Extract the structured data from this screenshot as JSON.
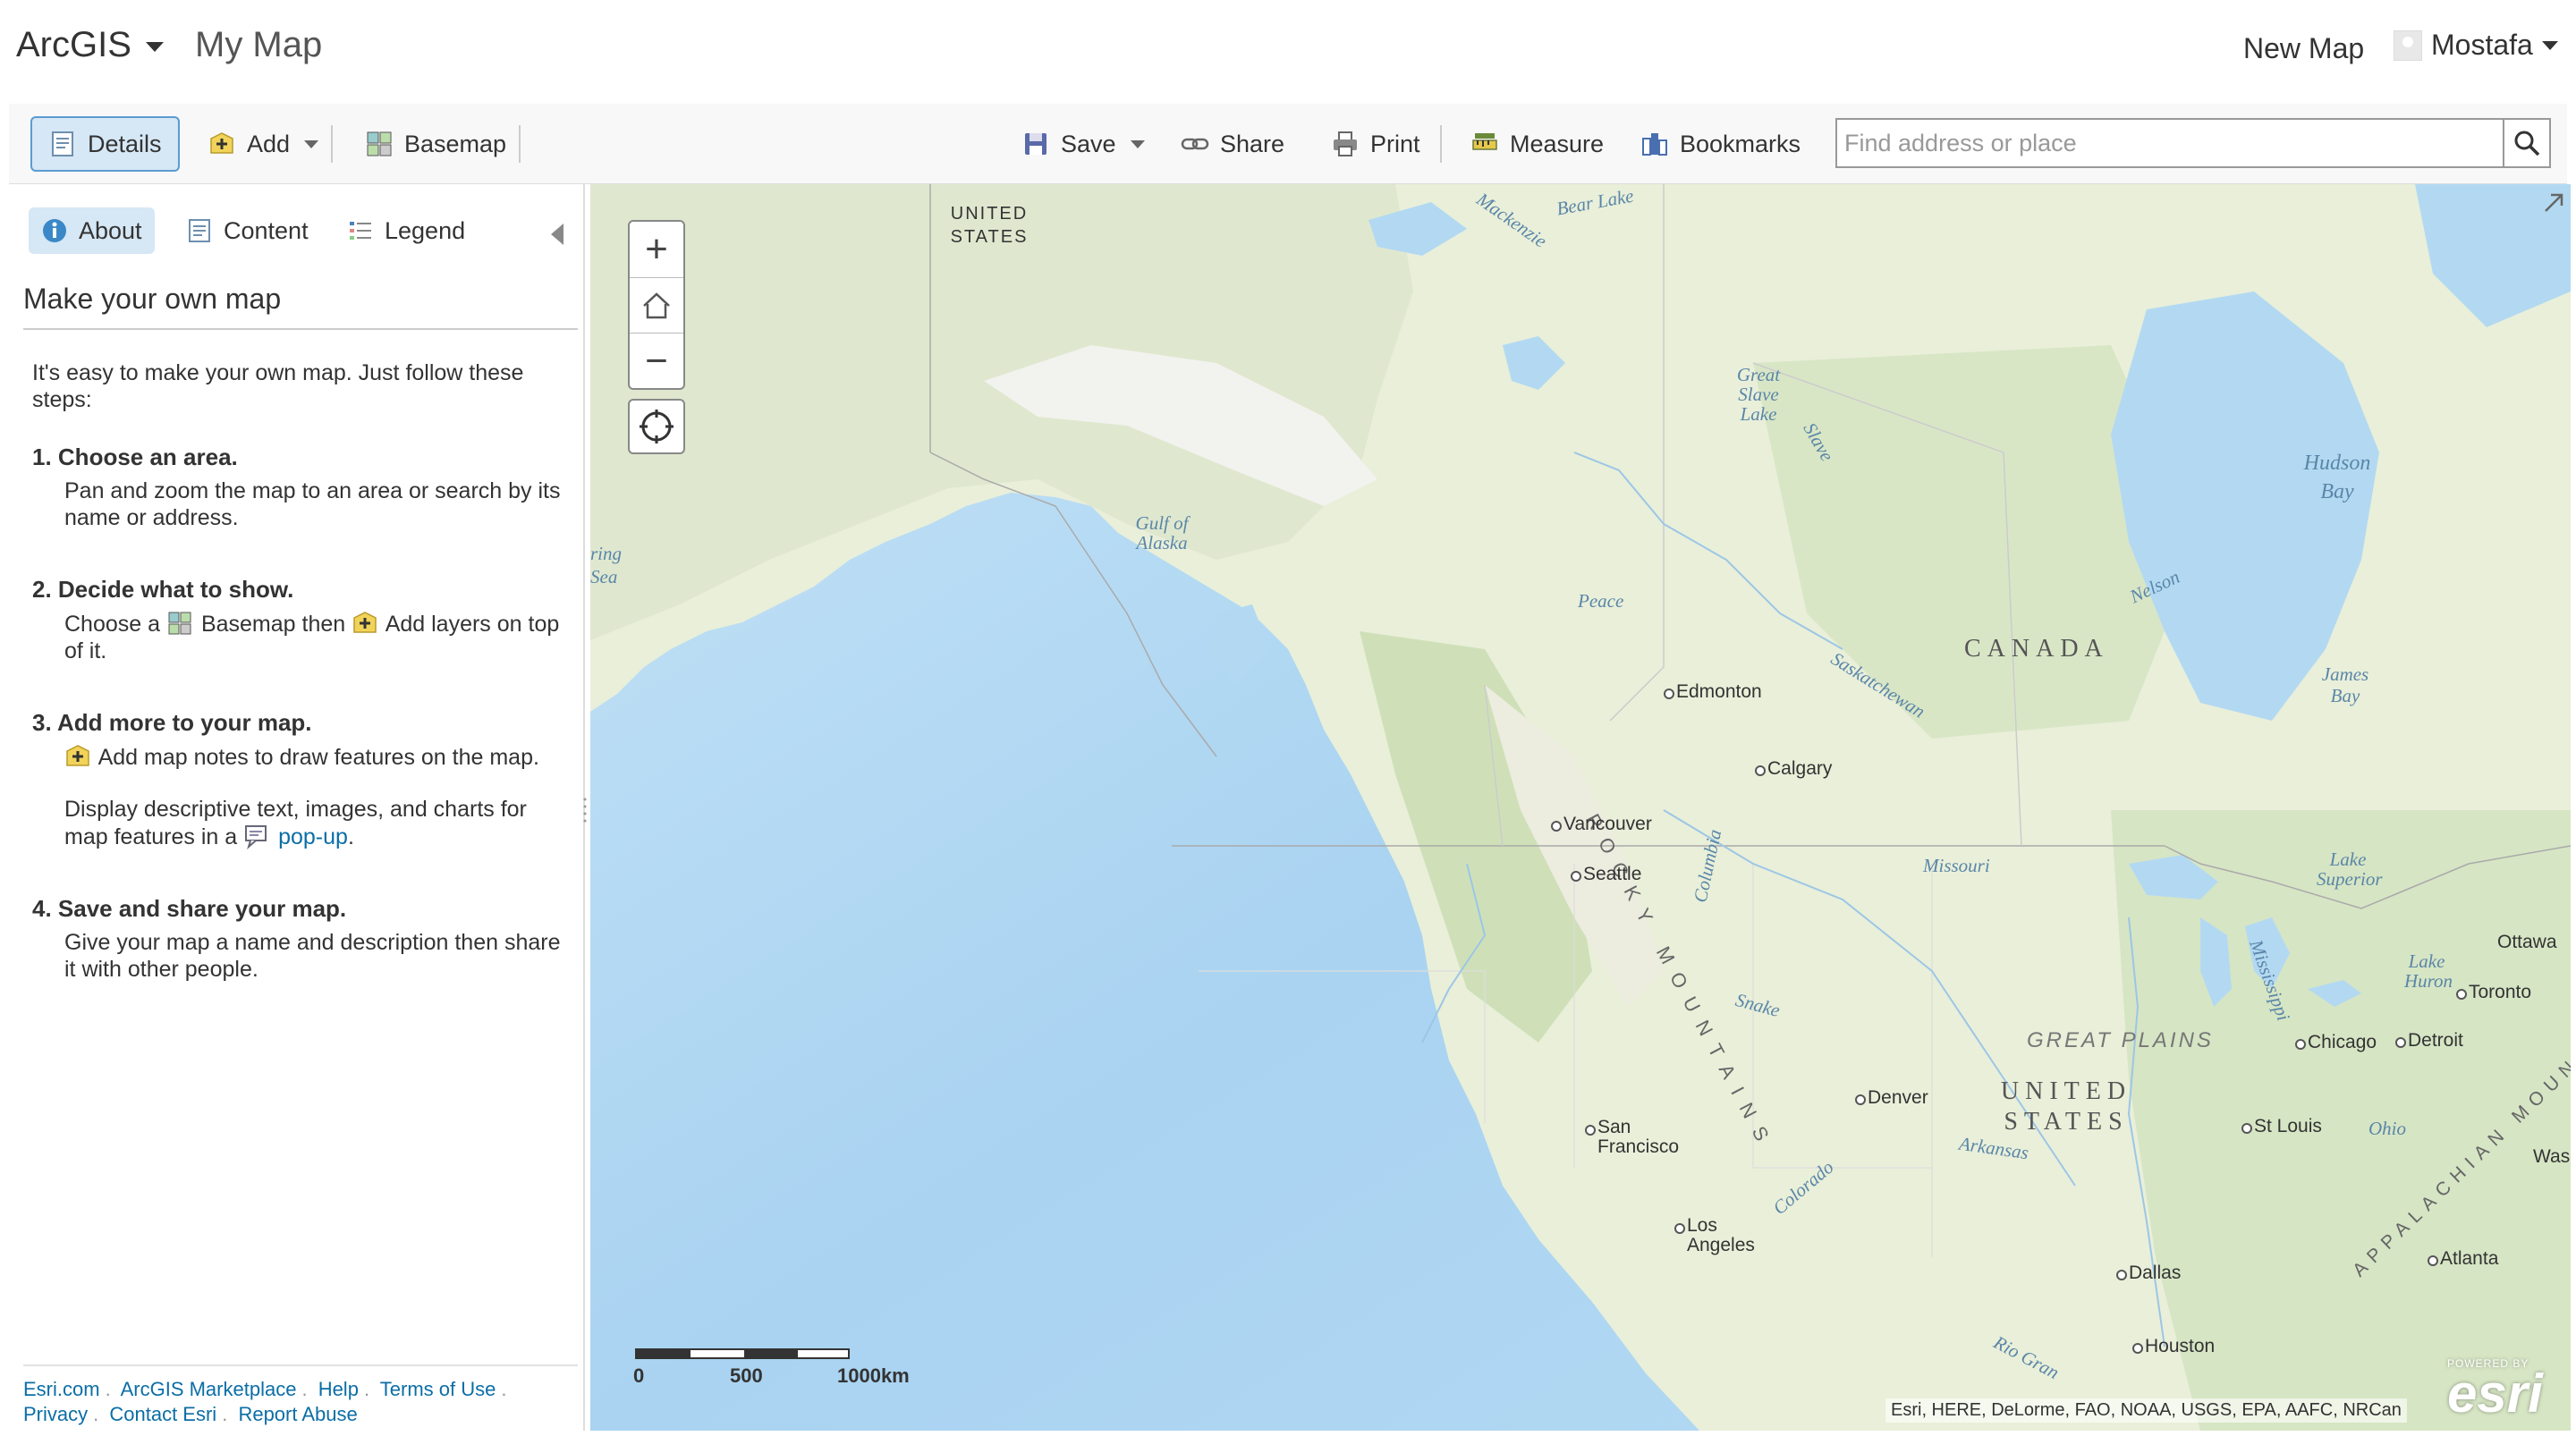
{
  "header": {
    "brand": "ArcGIS",
    "map_title": "My Map",
    "new_map": "New Map",
    "user": "Mostafa"
  },
  "toolbar": {
    "details": "Details",
    "add": "Add",
    "basemap": "Basemap",
    "save": "Save",
    "share": "Share",
    "print": "Print",
    "measure": "Measure",
    "bookmarks": "Bookmarks",
    "search_placeholder": "Find address or place"
  },
  "sidebar": {
    "tabs": {
      "about": "About",
      "content": "Content",
      "legend": "Legend"
    },
    "heading": "Make your own map",
    "intro": "It's easy to make your own map. Just follow these steps:",
    "steps": [
      {
        "title": "1. Choose an area.",
        "text": "Pan and zoom the map to an area or search by its name or address."
      },
      {
        "title": "2. Decide what to show.",
        "text_a": "Choose a",
        "text_b": "Basemap then",
        "text_c": "Add layers on top of it."
      },
      {
        "title": "3. Add more to your map.",
        "text": "Add map notes to draw features on the map.",
        "text2": "Display descriptive text, images, and charts for map features in a",
        "link": "pop-up",
        "tail": "."
      },
      {
        "title": "4. Save and share your map.",
        "text": "Give your map a name and description then share it with other people."
      }
    ],
    "footer": {
      "links": [
        "Esri.com",
        "ArcGIS Marketplace",
        "Help",
        "Terms of Use"
      ],
      "links2": [
        "Privacy",
        "Contact Esri",
        "Report Abuse"
      ]
    }
  },
  "map": {
    "labels": {
      "us_north": "UNITED STATES",
      "bear_lake": "Bear Lake",
      "mackenzie": "Mackenzie",
      "great_slave": "Great Slave Lake",
      "slave": "Slave",
      "hudson": "Hudson Bay",
      "gulf_alaska": "Gulf of Alaska",
      "bering": "ring Sea",
      "nelson": "Nelson",
      "peace": "Peace",
      "canada": "CANADA",
      "saskatchewan": "Saskatchewan",
      "edmonton": "Edmonton",
      "james_bay": "James Bay",
      "calgary": "Calgary",
      "rocky": "ROCKY MOUNTAINS",
      "vancouver": "Vancouver",
      "seattle": "Seattle",
      "columbia": "Columbia",
      "missouri": "Missouri",
      "lake_superior": "Lake Superior",
      "ottawa": "Ottawa",
      "lake_huron": "Lake Huron",
      "toronto": "Toronto",
      "mississippi": "Mississippi",
      "snake": "Snake",
      "great_plains": "GREAT PLAINS",
      "chicago": "Chicago",
      "detroit": "Detroit",
      "denver": "Denver",
      "us_south": "UNITED STATES",
      "san_francisco": "San Francisco",
      "st_louis": "St Louis",
      "ohio": "Ohio",
      "arkansas": "Arkansas",
      "washington": "Washi",
      "appalachian": "APPALACHIAN MOUN",
      "colorado": "Colorado",
      "los_angeles": "Los Angeles",
      "atlanta": "Atlanta",
      "dallas": "Dallas",
      "houston": "Houston",
      "rio_grande": "Rio Gran"
    },
    "scale": {
      "s0": "0",
      "s500": "500",
      "s1000": "1000km"
    },
    "attribution": "Esri, HERE, DeLorme, FAO, NOAA, USGS, EPA, AAFC, NRCan",
    "powered_by": "POWERED BY",
    "esri_logo": "esri"
  },
  "colors": {
    "accent": "#0b6ea6",
    "active_bg": "#d6e7f5",
    "ocean": "#b8dcf4",
    "land": "#e8eed8"
  }
}
